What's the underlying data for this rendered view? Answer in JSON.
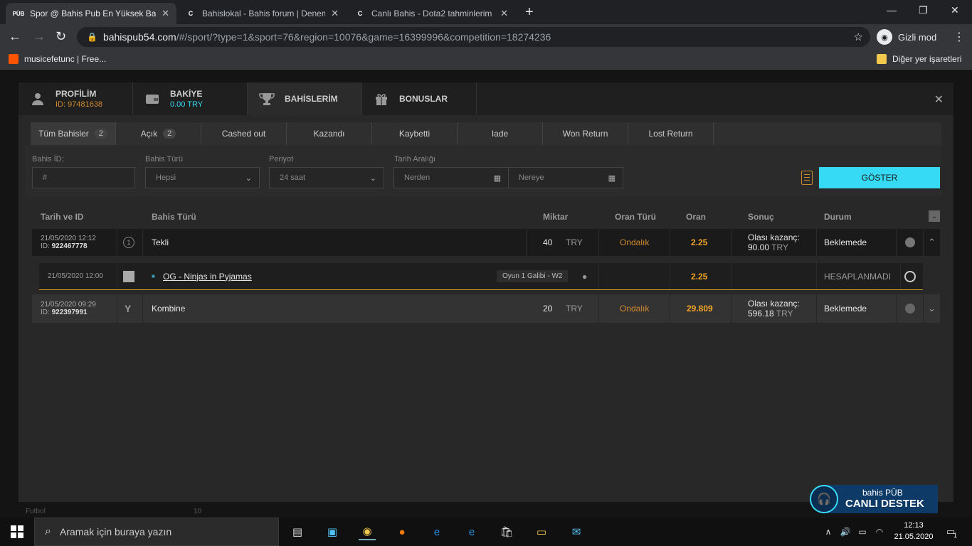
{
  "browser": {
    "tabs": [
      {
        "title": "Spor @ Bahis Pub En Yüksek Bahis",
        "fav": "PÜB",
        "fav_color": "#ffffff",
        "active": true
      },
      {
        "title": "Bahislokal - Bahis forum | Denem",
        "fav": "C",
        "fav_color": "#bdc1c6",
        "active": false
      },
      {
        "title": "Canlı Bahis - Dota2 tahminlerim",
        "fav": "C",
        "fav_color": "#bdc1c6",
        "active": false
      }
    ],
    "url_host": "bahispub54.com",
    "url_path": "/#/sport/?type=1&sport=76&region=10076&game=16399996&competition=18274236",
    "incognito_label": "Gizli mod",
    "bookmark_left": "musicefetunc | Free...",
    "bookmark_right": "Diğer yer işaretleri"
  },
  "modal": {
    "tabs": [
      {
        "label": "PROFİLİM",
        "sub": "ID: 97481638",
        "icon": "user-icon"
      },
      {
        "label": "BAKİYE",
        "sub": "0.00 TRY",
        "icon": "wallet-icon"
      },
      {
        "label": "BAHİSLERİM",
        "sub": "",
        "icon": "trophy-icon"
      },
      {
        "label": "BONUSLAR",
        "sub": "",
        "icon": "gift-icon"
      }
    ],
    "subtabs": [
      {
        "label": "Tüm Bahisler",
        "count": "2"
      },
      {
        "label": "Açık",
        "count": "2"
      },
      {
        "label": "Cashed out",
        "count": ""
      },
      {
        "label": "Kazandı",
        "count": ""
      },
      {
        "label": "Kaybetti",
        "count": ""
      },
      {
        "label": "Iade",
        "count": ""
      },
      {
        "label": "Won Return",
        "count": ""
      },
      {
        "label": "Lost Return",
        "count": ""
      }
    ],
    "filters": {
      "bet_id_label": "Bahis İD:",
      "bet_id_placeholder": "#",
      "bet_type_label": "Bahis Türü",
      "bet_type_value": "Hepsi",
      "period_label": "Periyot",
      "period_value": "24 saat",
      "range_label": "Tarih Aralığı",
      "from_placeholder": "Nerden",
      "to_placeholder": "Nereye",
      "show_button": "GÖSTER"
    },
    "columns": {
      "date": "Tarih ve ID",
      "type": "Bahis Türü",
      "amount": "Miktar",
      "odds_type": "Oran Türü",
      "odds": "Oran",
      "result": "Sonuç",
      "status": "Durum"
    },
    "bets": [
      {
        "date": "21/05/2020 12:12",
        "id_prefix": "ID:",
        "id": "922467778",
        "type_icon": "1",
        "type": "Tekli",
        "amount": "40",
        "currency": "TRY",
        "odds_type": "Ondalık",
        "odds": "2.25",
        "result_label": "Olası kazanç:",
        "result_amount": "90.00",
        "result_currency": "TRY",
        "status": "Beklemede"
      },
      {
        "date": "21/05/2020 09:29",
        "id_prefix": "ID:",
        "id": "922397991",
        "type_icon": "Y",
        "type": "Kombine",
        "amount": "20",
        "currency": "TRY",
        "odds_type": "Ondalık",
        "odds": "29.809",
        "result_label": "Olası kazanç:",
        "result_amount": "596.18",
        "result_currency": "TRY",
        "status": "Beklemede"
      }
    ],
    "selection": {
      "date": "21/05/2020 12:00",
      "match": "OG - Ninjas in Pyjamas",
      "market": "Oyun 1 Galibi - W2",
      "odds": "2.25",
      "status": "HESAPLANMADI"
    }
  },
  "support": {
    "brand": "bahis PÜB",
    "label": "CANLI DESTEK"
  },
  "backdrop": {
    "sport": "Futbol",
    "count": "10"
  },
  "taskbar": {
    "search_placeholder": "Aramak için buraya yazın",
    "time": "12:13",
    "date": "21.05.2020",
    "notif_count": "1"
  }
}
